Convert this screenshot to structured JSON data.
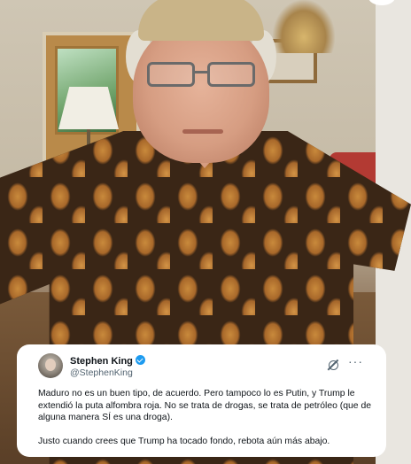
{
  "tweet": {
    "display_name": "Stephen King",
    "handle": "@StephenKing",
    "verified": true,
    "paragraphs": [
      "Maduro no es un buen tipo, de acuerdo. Pero tampoco lo es Putin, y Trump le extendió la puta alfombra roja. No se trata de drogas, se trata de petróleo (que de alguna manera SÍ es una droga).",
      "Justo cuando crees que Trump ha tocado fondo, rebota aún más abajo."
    ],
    "icons": {
      "verified": "verified-badge-icon",
      "grok": "grok-icon",
      "more": "more-options-icon"
    },
    "more_glyph": "···"
  },
  "colors": {
    "verified_blue": "#1d9bf0",
    "text_primary": "#0f1419",
    "text_secondary": "#536471",
    "card_bg": "#ffffff"
  }
}
